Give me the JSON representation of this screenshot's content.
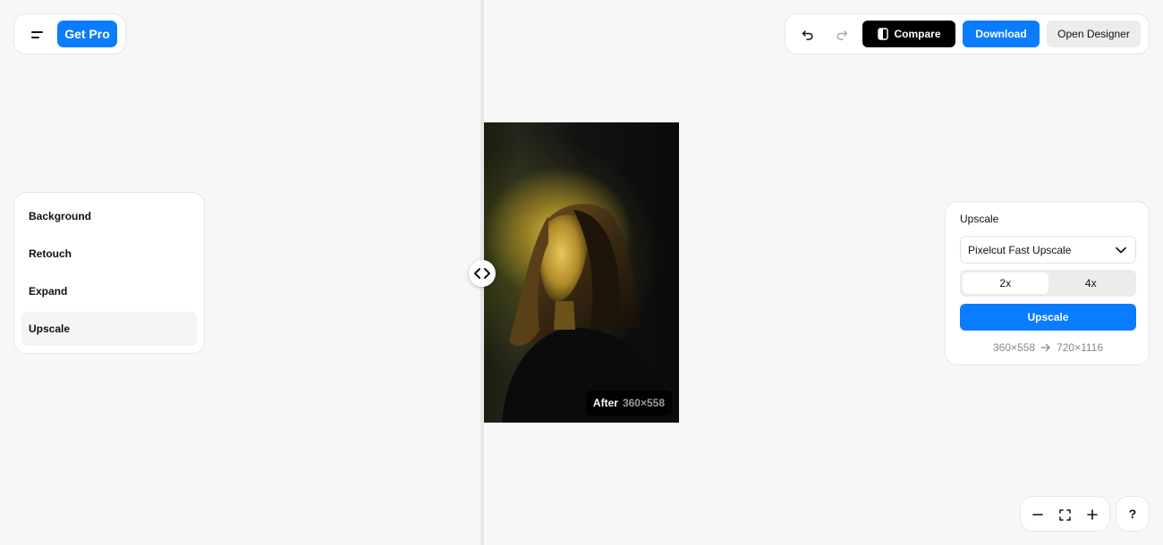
{
  "header": {
    "get_pro_label": "Get Pro"
  },
  "toolbar": {
    "compare_label": "Compare",
    "download_label": "Download",
    "open_designer_label": "Open Designer"
  },
  "sidebar": {
    "items": [
      {
        "label": "Background",
        "active": false
      },
      {
        "label": "Retouch",
        "active": false
      },
      {
        "label": "Expand",
        "active": false
      },
      {
        "label": "Upscale",
        "active": true
      }
    ]
  },
  "canvas": {
    "badge_label": "After",
    "badge_dims": "360×558"
  },
  "upscale_panel": {
    "title": "Upscale",
    "model_selected": "Pixelcut Fast Upscale",
    "scale_options": [
      "2x",
      "4x"
    ],
    "scale_selected": "2x",
    "button_label": "Upscale",
    "from_dims": "360×558",
    "to_dims": "720×1116"
  },
  "help": {
    "label": "?"
  },
  "colors": {
    "accent": "#0a7cff",
    "background": "#f7f7f7"
  }
}
